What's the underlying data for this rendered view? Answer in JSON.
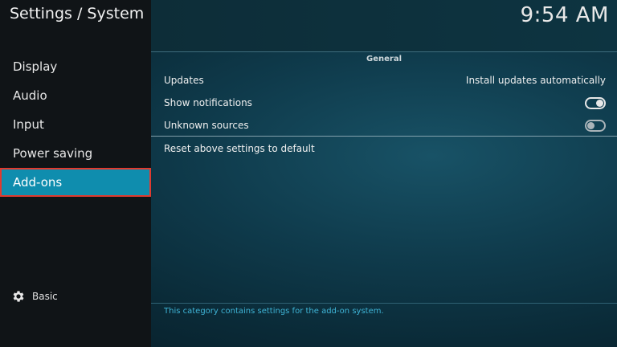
{
  "header": {
    "title": "Settings / System",
    "clock": "9:54 AM"
  },
  "sidebar": {
    "items": [
      {
        "label": "Display",
        "selected": false
      },
      {
        "label": "Audio",
        "selected": false
      },
      {
        "label": "Input",
        "selected": false
      },
      {
        "label": "Power saving",
        "selected": false
      },
      {
        "label": "Add-ons",
        "selected": true
      }
    ],
    "settings_level": {
      "icon": "gear-icon",
      "label": "Basic"
    }
  },
  "main": {
    "section_title": "General",
    "settings": [
      {
        "label": "Updates",
        "value": "Install updates automatically"
      },
      {
        "label": "Show notifications",
        "toggle": true
      },
      {
        "label": "Unknown sources",
        "toggle": false
      }
    ],
    "reset_label": "Reset above settings to default",
    "description": "This category contains settings for the add-on system."
  },
  "colors": {
    "accent": "#0f8dae",
    "highlight_border": "#e03a2f",
    "description_text": "#3fb4d6"
  }
}
